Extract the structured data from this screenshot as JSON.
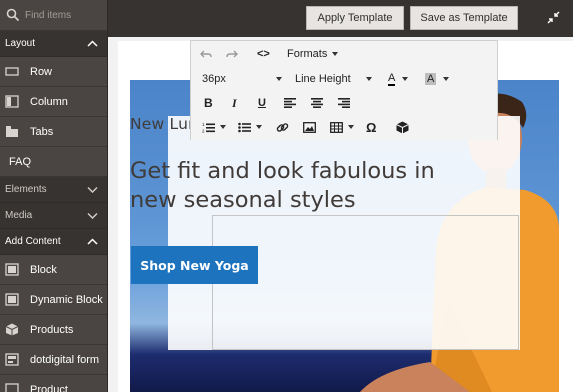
{
  "sidebar": {
    "search_placeholder": "Find items",
    "sections": {
      "layout": "Layout",
      "elements": "Elements",
      "media": "Media",
      "add_content": "Add Content"
    },
    "layout_items": [
      {
        "label": "Row",
        "icon": "row-icon"
      },
      {
        "label": "Column",
        "icon": "column-icon"
      },
      {
        "label": "Tabs",
        "icon": "tabs-icon"
      },
      {
        "label": "FAQ",
        "icon": ""
      }
    ],
    "content_items": [
      {
        "label": "Block",
        "icon": "block-icon"
      },
      {
        "label": "Dynamic Block",
        "icon": "dynamic-block-icon"
      },
      {
        "label": "Products",
        "icon": "products-icon"
      },
      {
        "label": "dotdigital form",
        "icon": "dotdigital-form-icon"
      },
      {
        "label": "Product",
        "icon": "product-icon"
      }
    ]
  },
  "header": {
    "apply_template": "Apply Template",
    "save_as_template": "Save as Template"
  },
  "editor": {
    "formats": "Formats",
    "font_size": "36px",
    "line_height": "Line Height",
    "text_color_glyph": "A",
    "bg_color_glyph": "A",
    "bold": "B",
    "italic": "I",
    "underline": "U",
    "special_char": "Ω",
    "code": "<>"
  },
  "banner": {
    "headline": "New Luma Yoga Collection",
    "subline": "Get fit and look fabulous in new seasonal styles",
    "button": "Shop New Yoga"
  },
  "colors": {
    "sidebar_bg": "#4a4542",
    "section_bg": "#373330",
    "button_primary": "#1e73be"
  }
}
